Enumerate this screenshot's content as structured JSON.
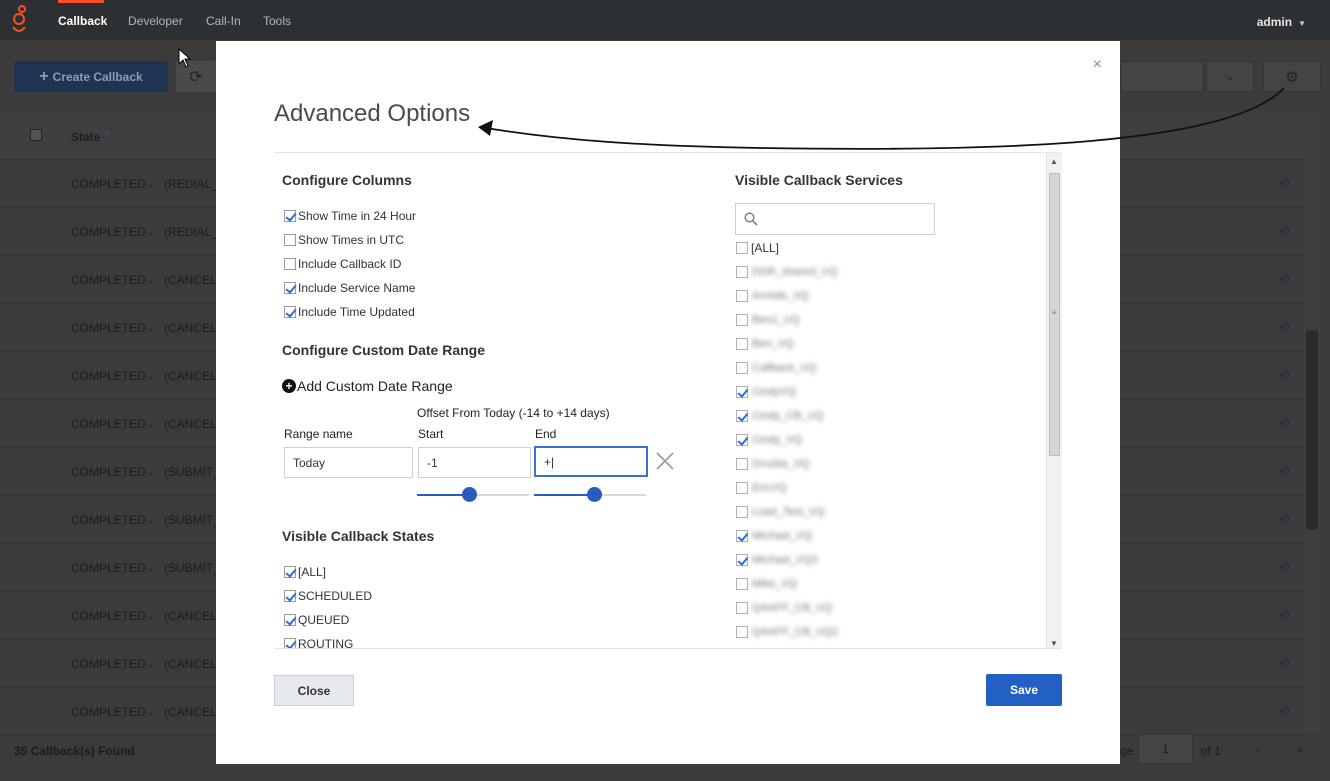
{
  "topbar": {
    "nav": [
      "Callback",
      "Developer",
      "Call-In",
      "Tools"
    ],
    "active": "Callback",
    "user": "admin"
  },
  "background": {
    "create_button": "Create Callback",
    "header_state": "State",
    "rows": [
      {
        "state": "COMPLETED",
        "sub": "(REDIAL_"
      },
      {
        "state": "COMPLETED",
        "sub": "(REDIAL_"
      },
      {
        "state": "COMPLETED",
        "sub": "(CANCEL"
      },
      {
        "state": "COMPLETED",
        "sub": "(CANCEL"
      },
      {
        "state": "COMPLETED",
        "sub": "(CANCEL"
      },
      {
        "state": "COMPLETED",
        "sub": "(CANCEL"
      },
      {
        "state": "COMPLETED",
        "sub": "(SUBMIT_"
      },
      {
        "state": "COMPLETED",
        "sub": "(SUBMIT_"
      },
      {
        "state": "COMPLETED",
        "sub": "(SUBMIT_"
      },
      {
        "state": "COMPLETED",
        "sub": "(CANCEL"
      },
      {
        "state": "COMPLETED",
        "sub": "(CANCEL"
      },
      {
        "state": "COMPLETED",
        "sub": "(CANCEL"
      }
    ],
    "found_text": "35 Callback(s) Found",
    "page_label": "ge",
    "page_value": "1",
    "page_of": "of 1"
  },
  "modal": {
    "title": "Advanced Options",
    "configure_columns": {
      "title": "Configure Columns",
      "options": [
        {
          "label": "Show Time in 24 Hour",
          "checked": true
        },
        {
          "label": "Show Times in UTC",
          "checked": false
        },
        {
          "label": "Include Callback ID",
          "checked": false
        },
        {
          "label": "Include Service Name",
          "checked": true
        },
        {
          "label": "Include Time Updated",
          "checked": true
        }
      ]
    },
    "custom_date": {
      "title": "Configure Custom Date Range",
      "add_label": "Add Custom Date Range",
      "offset_label": "Offset From Today (-14 to +14 days)",
      "range_name_label": "Range name",
      "start_label": "Start",
      "end_label": "End",
      "range_name_value": "Today",
      "start_value": "-1",
      "end_value": "+|",
      "start_slider_fraction": 0.46,
      "end_slider_fraction": 0.54
    },
    "states": {
      "title": "Visible Callback States",
      "options": [
        {
          "label": "[ALL]",
          "checked": true
        },
        {
          "label": "SCHEDULED",
          "checked": true
        },
        {
          "label": "QUEUED",
          "checked": true
        },
        {
          "label": "ROUTING",
          "checked": true
        }
      ]
    },
    "services": {
      "title": "Visible Callback Services",
      "search_placeholder": "",
      "all_label": "[ALL]",
      "items": [
        {
          "label": "DDR_shared_VQ",
          "checked": false
        },
        {
          "label": "Armide_VQ",
          "checked": false
        },
        {
          "label": "Ben2_VQ",
          "checked": false
        },
        {
          "label": "Ben_VQ",
          "checked": false
        },
        {
          "label": "Callback_VQ",
          "checked": false
        },
        {
          "label": "CindyVQ",
          "checked": true
        },
        {
          "label": "Cindy_CB_VQ",
          "checked": true
        },
        {
          "label": "Cindy_VQ",
          "checked": true
        },
        {
          "label": "Druzba_VQ",
          "checked": false
        },
        {
          "label": "EricVQ",
          "checked": false
        },
        {
          "label": "Load_Test_VQ",
          "checked": false
        },
        {
          "label": "Michael_VQ",
          "checked": true
        },
        {
          "label": "Michael_VQ2",
          "checked": true
        },
        {
          "label": "Mike_VQ",
          "checked": false
        },
        {
          "label": "QAAFF_CB_VQ",
          "checked": false
        },
        {
          "label": "QAAFF_CB_VQ2",
          "checked": false
        }
      ]
    },
    "close_label": "Close",
    "save_label": "Save"
  }
}
